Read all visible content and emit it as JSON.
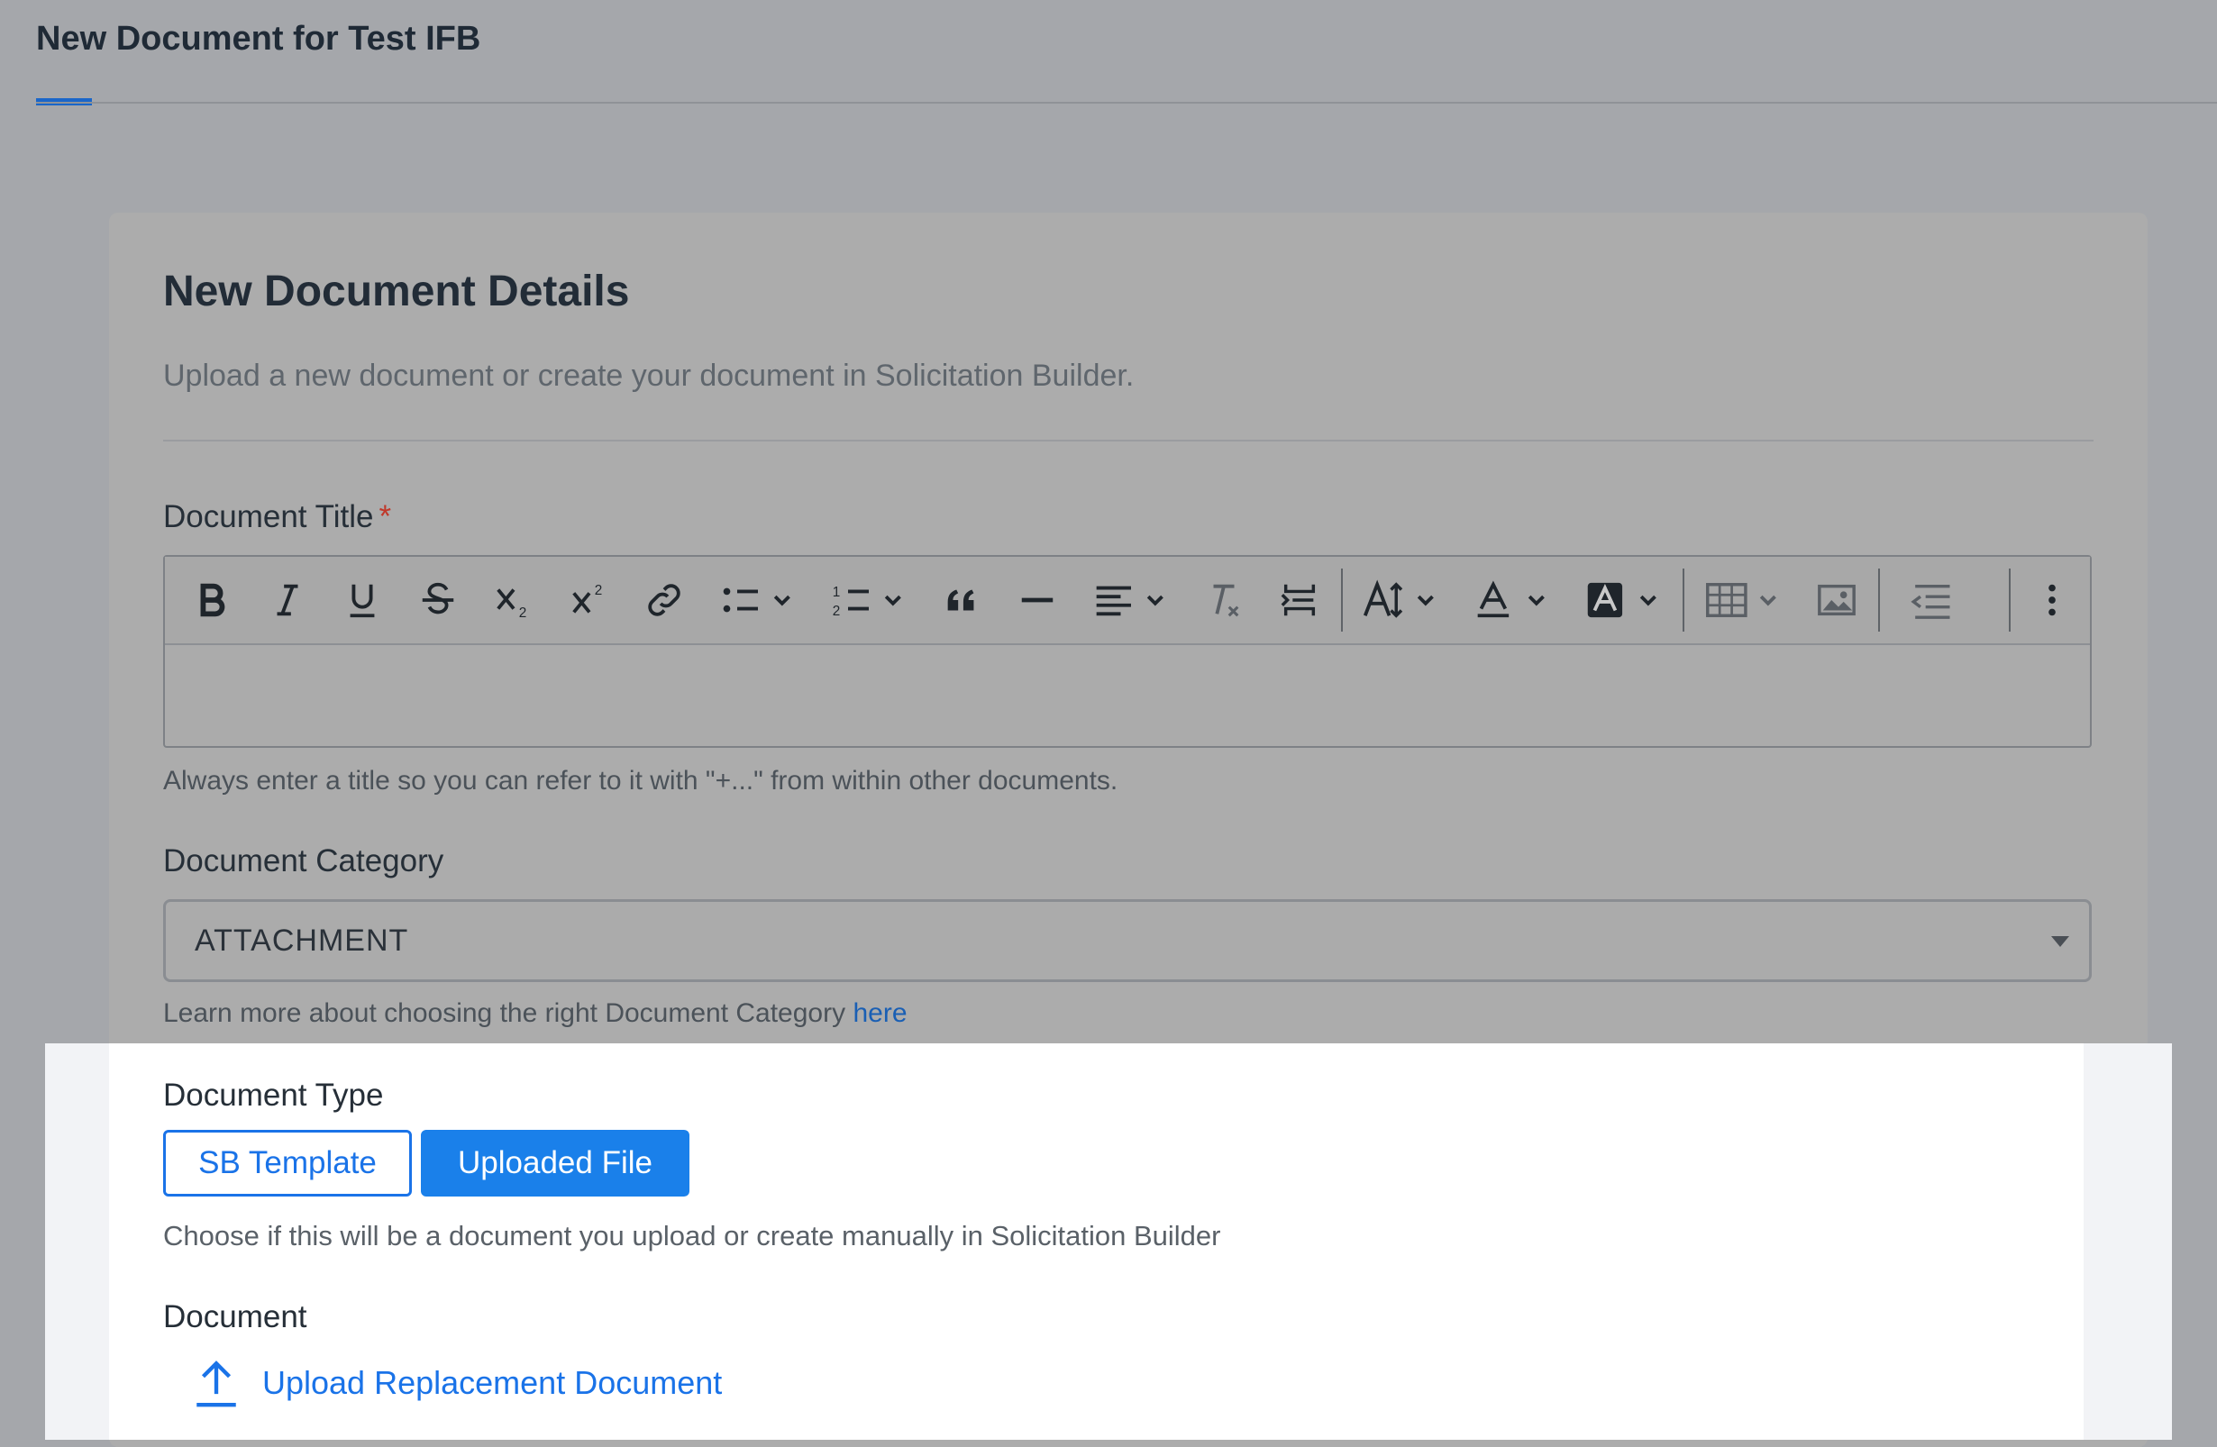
{
  "header": {
    "title": "New Document for Test IFB"
  },
  "card": {
    "title": "New Document Details",
    "subtitle": "Upload a new document or create your document in Solicitation Builder."
  },
  "document_title": {
    "label": "Document Title",
    "required_marker": "*",
    "hint": "Always enter a title so you can refer to it with \"+...\" from within other documents.",
    "toolbar": [
      "bold-icon",
      "italic-icon",
      "underline-icon",
      "strikethrough-icon",
      "subscript-icon",
      "superscript-icon",
      "link-icon",
      "bulleted-list-icon",
      "numbered-list-icon",
      "blockquote-icon",
      "horizontal-line-icon",
      "align-icon",
      "clear-formatting-icon",
      "page-break-icon",
      "font-size-icon",
      "font-color-icon",
      "highlight-color-icon",
      "table-icon",
      "image-icon",
      "outdent-icon",
      "more-options-icon"
    ]
  },
  "document_category": {
    "label": "Document Category",
    "value": "ATTACHMENT",
    "hint_prefix": "Learn more about choosing the right Document Category",
    "hint_link": "here"
  },
  "document_type": {
    "label": "Document Type",
    "options": [
      "SB Template",
      "Uploaded File"
    ],
    "selected": "Uploaded File",
    "hint": "Choose if this will be a document you upload or create manually in Solicitation Builder"
  },
  "document": {
    "label": "Document",
    "upload_label": "Upload Replacement Document"
  },
  "colors": {
    "accent": "#1a73e8",
    "required": "#c0392b",
    "overlay": "#a5a7ab"
  }
}
